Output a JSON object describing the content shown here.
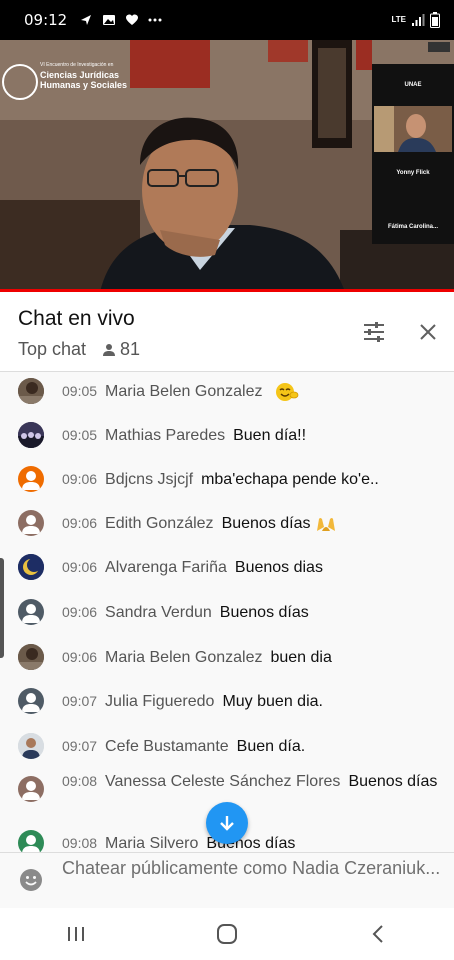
{
  "status_bar": {
    "time": "09:12",
    "network": "LTE",
    "icons": [
      "location-icon",
      "gallery-icon",
      "heart-icon",
      "more-dots-icon",
      "signal-icon",
      "battery-icon"
    ]
  },
  "video": {
    "conference_logo_small": "VI Encuentro de Investigación en",
    "conference_logo_main": "Ciencias Jurídicas Humanas y Sociales",
    "thumbs": [
      "UNAE",
      "Yonny Flick",
      "Fátima Carolina..."
    ]
  },
  "chat": {
    "title": "Chat en vivo",
    "mode": "Top chat",
    "viewers": "81"
  },
  "messages": [
    {
      "time": "09:05",
      "author": "Maria Belen Gonzalez",
      "text": "",
      "emoji": "smile-emoji"
    },
    {
      "time": "09:05",
      "author": "Mathias Paredes",
      "text": "Buen día!!"
    },
    {
      "time": "09:06",
      "author": "Bdjcns Jsjcjf",
      "text": "mba'echapa pende ko'e.."
    },
    {
      "time": "09:06",
      "author": "Edith González",
      "text": "Buenos días",
      "emoji": "raised-hands-emoji"
    },
    {
      "time": "09:06",
      "author": "Alvarenga Fariña",
      "text": "Buenos dias"
    },
    {
      "time": "09:06",
      "author": "Sandra Verdun",
      "text": "Buenos días"
    },
    {
      "time": "09:06",
      "author": "Maria Belen Gonzalez",
      "text": "buen dia"
    },
    {
      "time": "09:07",
      "author": "Julia Figueredo",
      "text": "Muy buen dia."
    },
    {
      "time": "09:07",
      "author": "Cefe Bustamante",
      "text": "Buen día."
    },
    {
      "time": "09:08",
      "author": "Vanessa Celeste Sánchez Flores",
      "text": "Buenos días"
    },
    {
      "time": "09:08",
      "author": "Maria Silvero",
      "text": "Buenos días"
    }
  ],
  "input": {
    "placeholder": "Chatear públicamente como Nadia Czeraniuk..."
  },
  "colors": {
    "accent_blue": "#2196f3",
    "progress_red": "#e00000",
    "avatar_orange": "#ef6c00",
    "avatar_slate": "#4f5b66",
    "avatar_green": "#2e8b57"
  }
}
